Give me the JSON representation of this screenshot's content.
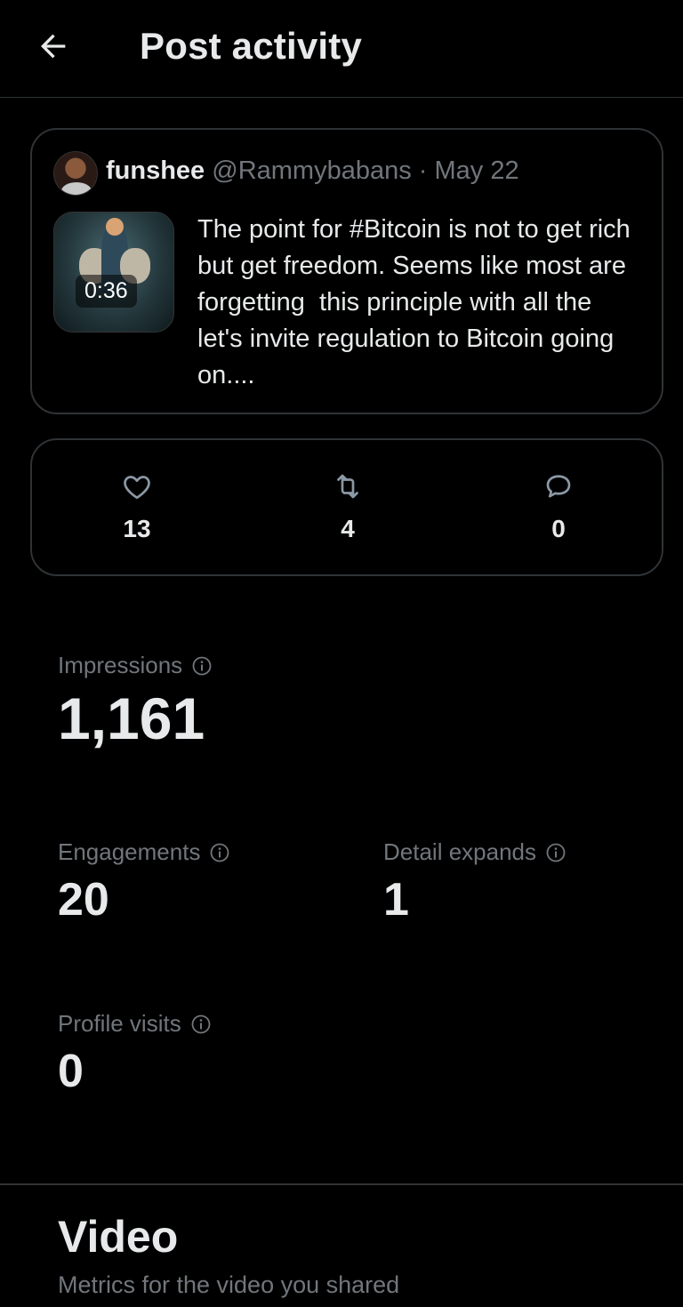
{
  "header": {
    "back_icon": "arrow-left-icon",
    "title": "Post activity"
  },
  "tweet": {
    "author_name": "funshee",
    "author_handle": "@Rammybabans",
    "separator": "·",
    "date": "May 22",
    "video_duration": "0:36",
    "text": "The point for #Bitcoin is not to get rich but get freedom. Seems like most are  forgetting  this principle with all the let's invite regulation to Bitcoin going on...."
  },
  "engagement_counts": {
    "likes": {
      "icon": "heart-icon",
      "value": "13"
    },
    "reposts": {
      "icon": "repost-icon",
      "value": "4"
    },
    "replies": {
      "icon": "reply-icon",
      "value": "0"
    }
  },
  "metrics": {
    "impressions": {
      "label": "Impressions",
      "value": "1,161"
    },
    "engagements": {
      "label": "Engagements",
      "value": "20"
    },
    "detail_expands": {
      "label": "Detail expands",
      "value": "1"
    },
    "profile_visits": {
      "label": "Profile visits",
      "value": "0"
    }
  },
  "video_section": {
    "title": "Video",
    "subtitle": "Metrics for the video you shared"
  },
  "colors": {
    "background": "#000000",
    "primary_text": "#e7e9ea",
    "secondary_text": "#71767b",
    "border": "#2f3336"
  }
}
